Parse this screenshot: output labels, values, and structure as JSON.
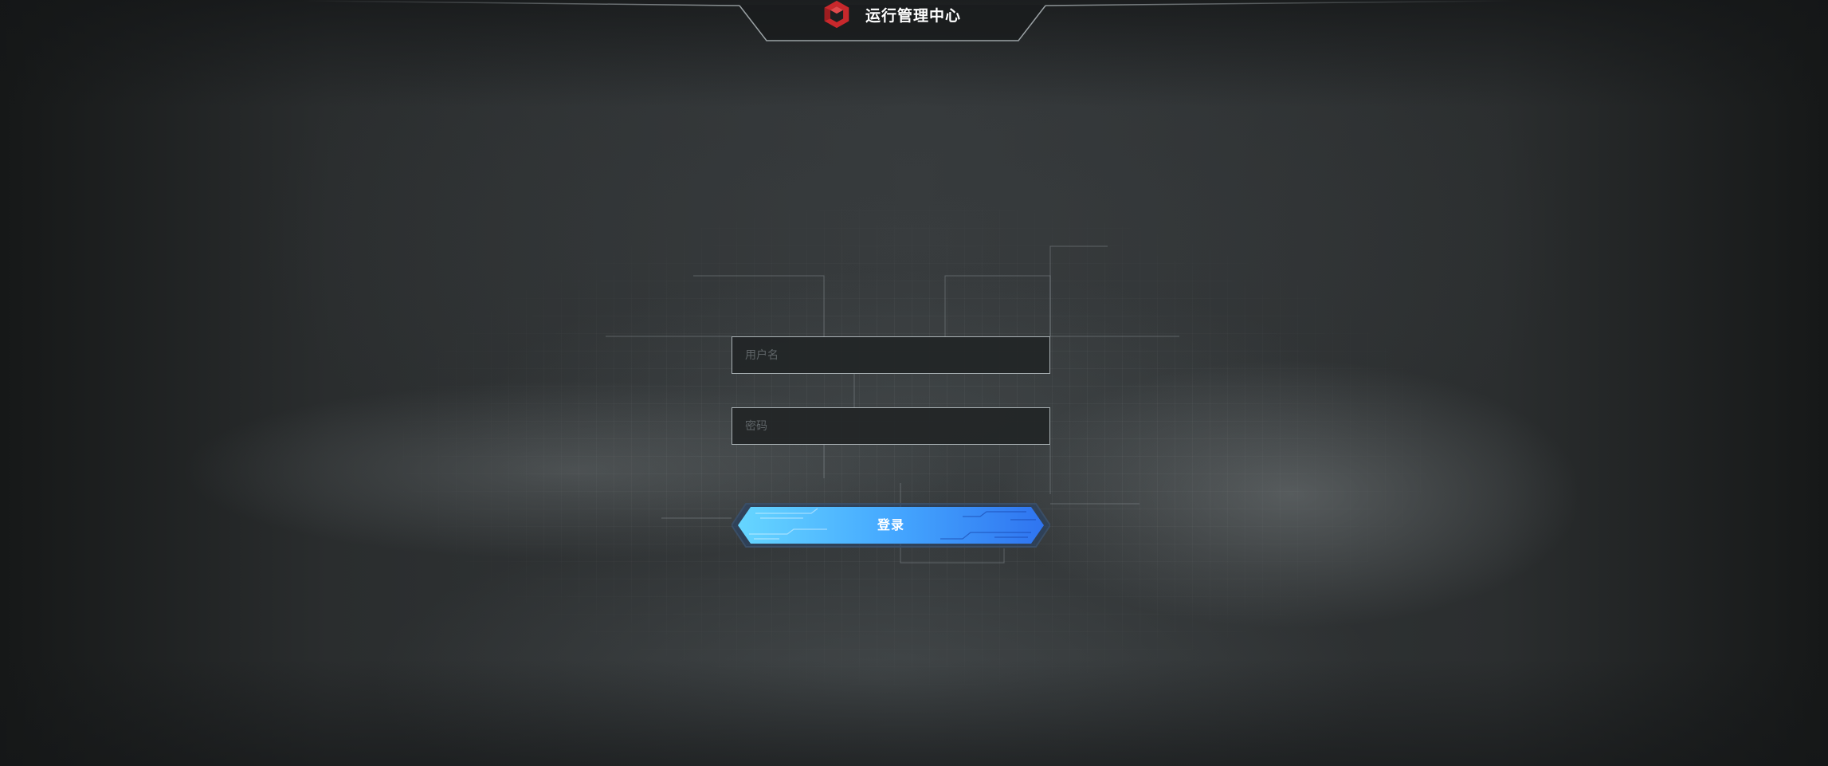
{
  "header": {
    "title": "运行管理中心",
    "logo_icon": "hexagon-logo-icon"
  },
  "login_form": {
    "username_placeholder": "用户名",
    "password_placeholder": "密码",
    "submit_label": "登录"
  },
  "colors": {
    "accent_blue": "#3a8dff",
    "accent_cyan": "#5fd3ff",
    "logo_red": "#c8282c",
    "field_border": "#a9b1b4"
  }
}
